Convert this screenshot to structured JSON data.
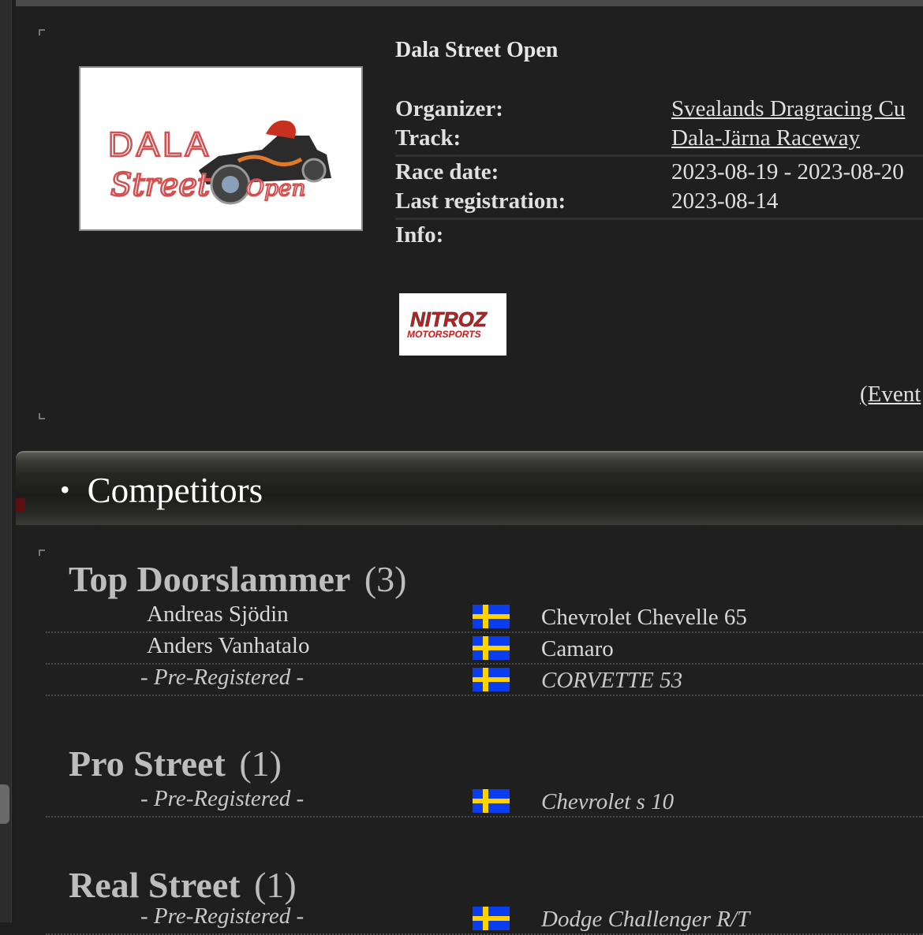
{
  "event": {
    "title": "Dala Street Open",
    "logo_text_1": "DALA",
    "logo_text_2": "Street",
    "logo_text_3": "Open",
    "info": [
      {
        "label": "Organizer:",
        "value": "Svealands Dragracing Cu",
        "link": true
      },
      {
        "label": "Track:",
        "value": "Dala-Järna Raceway",
        "link": true
      },
      {
        "label": "Race date:",
        "value": "2023-08-19 - 2023-08-20",
        "link": false
      },
      {
        "label": "Last registration:",
        "value": "2023-08-14",
        "link": false
      },
      {
        "label": "Info:",
        "value": "",
        "link": false
      }
    ],
    "sponsor_text_1": "NITROZ",
    "sponsor_text_2": "MOTORSPORTS",
    "event_link": "(Event"
  },
  "tabs": [
    {
      "label": "Competitors"
    }
  ],
  "classes": [
    {
      "name": "Top Doorslammer",
      "count": "(3)",
      "competitors": [
        {
          "name": "Andreas Sjödin",
          "car": "Chevrolet Chevelle 65",
          "pre": false
        },
        {
          "name": "Anders Vanhatalo",
          "car": "Camaro",
          "pre": false
        },
        {
          "name": "- Pre-Registered -",
          "car": "CORVETTE 53",
          "pre": true
        }
      ]
    },
    {
      "name": "Pro Street",
      "count": "(1)",
      "competitors": [
        {
          "name": "- Pre-Registered -",
          "car": "Chevrolet s 10",
          "pre": true
        }
      ]
    },
    {
      "name": "Real Street",
      "count": "(1)",
      "competitors": [
        {
          "name": "- Pre-Registered -",
          "car": "Dodge Challenger R/T",
          "pre": true
        }
      ]
    }
  ],
  "colors": {
    "background": "#1f1f1f",
    "flag_blue": "#0a3cf0",
    "flag_yellow": "#ffd200",
    "sponsor_red": "#d01818"
  }
}
